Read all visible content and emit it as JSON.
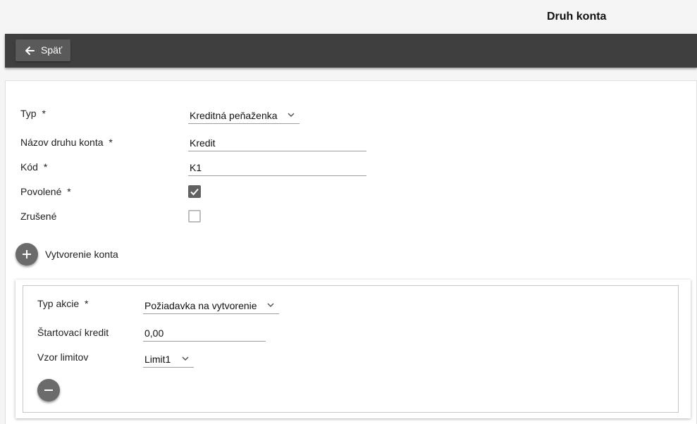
{
  "header": {
    "title": "Druh konta"
  },
  "toolbar": {
    "back_label": "Späť"
  },
  "form": {
    "type_label": "Typ",
    "type_value": "Kreditná peňaženka",
    "name_label": "Názov druhu konta",
    "name_value": "Kredit",
    "code_label": "Kód",
    "code_value": "K1",
    "enabled_label": "Povolené",
    "enabled_checked": true,
    "cancelled_label": "Zrušené",
    "cancelled_checked": false,
    "required_mark": "*"
  },
  "account_creation": {
    "label": "Vytvorenie konta",
    "action_type_label": "Typ akcie",
    "action_type_value": "Požiadavka na vytvorenie",
    "start_credit_label": "Štartovací kredit",
    "start_credit_value": "0,00",
    "limit_template_label": "Vzor limitov",
    "limit_template_value": "Limit1"
  },
  "colors": {
    "toolbar": "#3f3f3f",
    "button": "#5a5a5a",
    "fab": "#6b6b6b"
  }
}
